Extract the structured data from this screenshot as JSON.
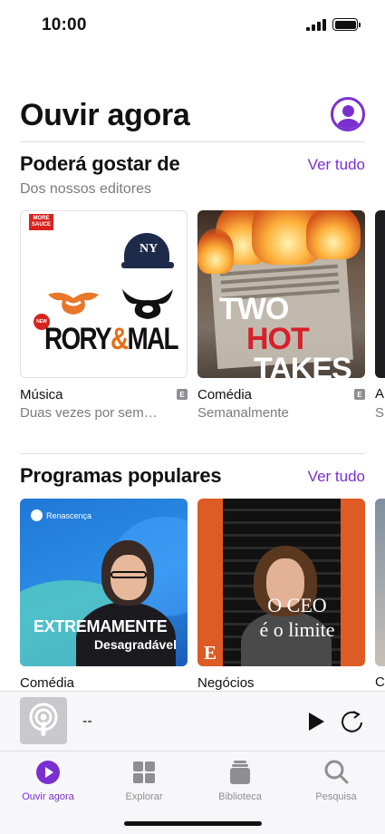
{
  "status_bar": {
    "time": "10:00"
  },
  "header": {
    "title": "Ouvir agora"
  },
  "sections": {
    "recommended": {
      "title": "Poderá gostar de",
      "see_all": "Ver tudo",
      "subtitle": "Dos nossos editores",
      "cards": [
        {
          "genre": "Música",
          "explicit": "E",
          "frequency": "Duas vezes por sem…",
          "art_title_a": "RORY",
          "art_amp": "&",
          "art_title_b": "MAL",
          "art_badge": "MORE SAUCE",
          "art_new": "NEW",
          "art_cap": "NY"
        },
        {
          "genre": "Comédia",
          "explicit": "E",
          "frequency": "Semanalmente",
          "art_line1": "TWO",
          "art_line2": "HOT",
          "art_line3": "TAKES"
        },
        {
          "genre": "A",
          "frequency": "S"
        }
      ]
    },
    "popular": {
      "title": "Programas populares",
      "see_all": "Ver tudo",
      "cards": [
        {
          "genre": "Comédia",
          "art_brand": "Renascença",
          "art_title": "EXTREMAMENTE",
          "art_subtitle": "Desagradável"
        },
        {
          "genre": "Negócios",
          "art_title_line1": "O CEO",
          "art_title_line2": "é o limite",
          "art_logo": "E"
        },
        {
          "genre": "C"
        }
      ]
    }
  },
  "mini_player": {
    "title": "--"
  },
  "tab_bar": {
    "tabs": [
      {
        "label": "Ouvir agora",
        "icon": "play-circle-icon",
        "active": true
      },
      {
        "label": "Explorar",
        "icon": "grid-icon",
        "active": false
      },
      {
        "label": "Biblioteca",
        "icon": "library-stack-icon",
        "active": false
      },
      {
        "label": "Pesquisa",
        "icon": "search-icon",
        "active": false
      }
    ]
  },
  "colors": {
    "accent": "#7b2fd0",
    "secondary_text": "#7a7a80",
    "explicit_badge": "#8e8e93"
  }
}
